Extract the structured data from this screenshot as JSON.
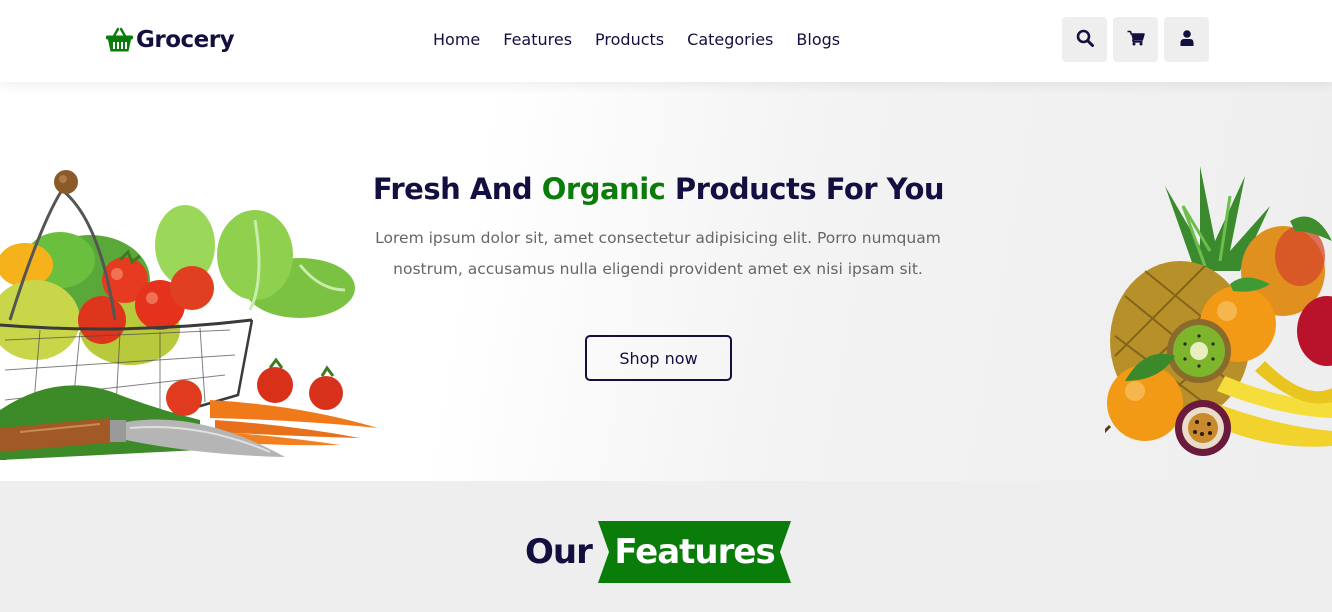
{
  "brand": {
    "name": "Grocery",
    "icon": "shopping-basket-icon",
    "accent_color": "#0a7c0a",
    "text_color": "#130f40"
  },
  "nav": {
    "items": [
      {
        "label": "Home"
      },
      {
        "label": "Features"
      },
      {
        "label": "Products"
      },
      {
        "label": "Categories"
      },
      {
        "label": "Blogs"
      }
    ]
  },
  "header_icons": {
    "search": "search-icon",
    "cart": "cart-icon",
    "user": "user-icon"
  },
  "hero": {
    "title_part1": "Fresh And ",
    "title_accent": "Organic",
    "title_part2": " Products For You",
    "description": "Lorem ipsum dolor sit, amet consectetur adipisicing elit. Porro numquam nostrum, accusamus nulla eligendi provident amet ex nisi ipsam sit.",
    "button_label": "Shop now"
  },
  "features": {
    "heading_part1": "Our",
    "heading_part2": "Features"
  }
}
